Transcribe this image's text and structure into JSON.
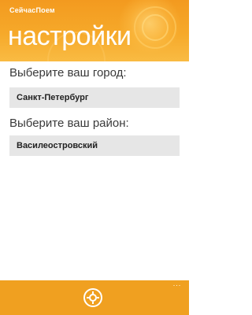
{
  "header": {
    "app_title": "СейчасПоем",
    "page_title": "настройки"
  },
  "settings": {
    "city_label": "Выберите ваш город:",
    "city_value": "Санкт-Петербург",
    "district_label": "Выберите ваш район:",
    "district_value": "Василеостровский"
  },
  "appbar": {
    "primary_icon": "locate-icon",
    "more_label": "..."
  },
  "colors": {
    "accent": "#f0a020",
    "select_bg": "#e6e6e6"
  }
}
